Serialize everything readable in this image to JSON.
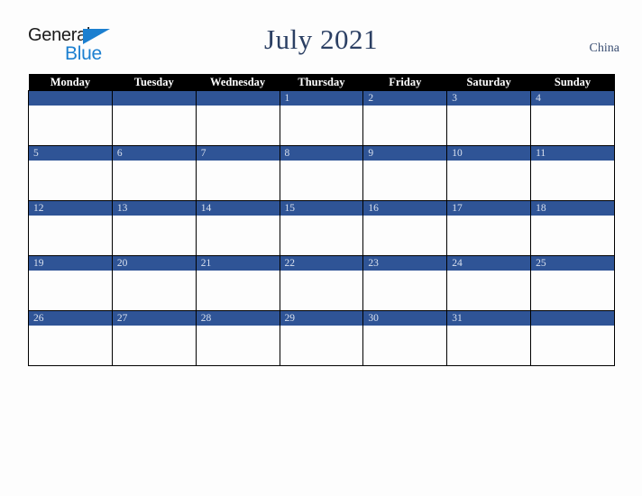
{
  "brand": {
    "name_part1": "General",
    "name_part2": "Blue",
    "triangle_icon": "triangle-icon",
    "accent_color": "#1b7fd0",
    "text_color": "#1a1a1a"
  },
  "header": {
    "title": "July 2021",
    "country": "China",
    "title_color": "#2b3f63"
  },
  "calendar": {
    "month": "July",
    "year": "2021",
    "week_start": "Monday",
    "band_color": "#2f5496",
    "header_bg": "#000000",
    "header_text_color": "#ffffff",
    "daynum_color": "#d8e0ee",
    "weekdays": [
      "Monday",
      "Tuesday",
      "Wednesday",
      "Thursday",
      "Friday",
      "Saturday",
      "Sunday"
    ],
    "weeks": [
      [
        "",
        "",
        "",
        "1",
        "2",
        "3",
        "4"
      ],
      [
        "5",
        "6",
        "7",
        "8",
        "9",
        "10",
        "11"
      ],
      [
        "12",
        "13",
        "14",
        "15",
        "16",
        "17",
        "18"
      ],
      [
        "19",
        "20",
        "21",
        "22",
        "23",
        "24",
        "25"
      ],
      [
        "26",
        "27",
        "28",
        "29",
        "30",
        "31",
        ""
      ]
    ]
  }
}
